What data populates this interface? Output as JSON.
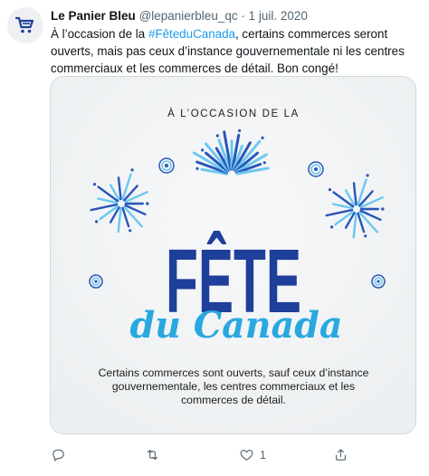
{
  "tweet": {
    "author_name": "Le Panier Bleu",
    "author_handle": "@lepanierbleu_qc",
    "separator": "·",
    "date": "1 juil. 2020",
    "text_before": "À l’occasion de la ",
    "hashtag": "#FêteduCanada",
    "text_after": ", certains commerces seront ouverts, mais pas  ceux d’instance gouvernementale ni les centres commerciaux et les commerces de détail. Bon congé!"
  },
  "image": {
    "top_line": "À L’OCCASION DE LA",
    "title_main": "FÊTE",
    "title_script": "du Canada",
    "footer_lines": [
      "Certains commerces sont ouverts, sauf ceux d’instance",
      "gouvernementale, les centres commerciaux et les",
      "commerces de détail."
    ]
  },
  "actions": {
    "reply_count": "",
    "retweet_count": "",
    "like_count": "1",
    "share_count": ""
  },
  "colors": {
    "hashtag": "#1d9bf0",
    "title_blue": "#1e3f9a",
    "script_cyan": "#29a8e0",
    "firework_light": "#6dc8ef",
    "firework_dark": "#2b56b8",
    "avatar_cart": "#1e3f9a"
  },
  "icons": [
    "shopping-cart-icon",
    "reply-icon",
    "retweet-icon",
    "like-icon",
    "share-icon",
    "firework-icon",
    "swirl-icon"
  ]
}
